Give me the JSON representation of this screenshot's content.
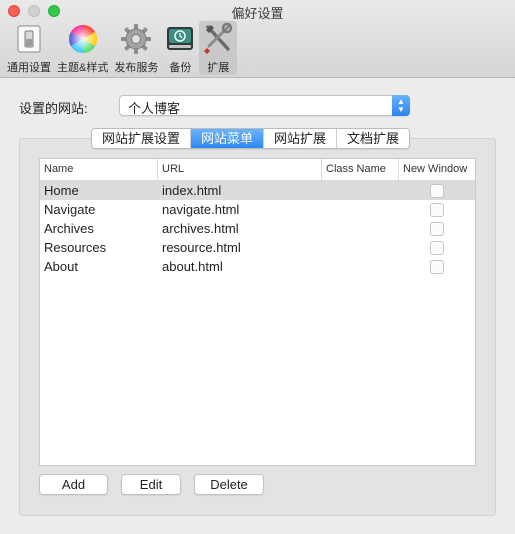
{
  "window": {
    "title": "偏好设置"
  },
  "toolbar": {
    "items": [
      {
        "label": "通用设置",
        "icon": "switch-icon"
      },
      {
        "label": "主题&样式",
        "icon": "color-wheel-icon"
      },
      {
        "label": "发布服务",
        "icon": "gear-icon"
      },
      {
        "label": "备份",
        "icon": "time-machine-drive-icon"
      },
      {
        "label": "扩展",
        "icon": "tools-icon"
      }
    ],
    "active": "扩展"
  },
  "site": {
    "label": "设置的网站:",
    "selected": "个人博客"
  },
  "tabs": [
    {
      "label": "网站扩展设置"
    },
    {
      "label": "网站菜单"
    },
    {
      "label": "网站扩展"
    },
    {
      "label": "文档扩展"
    }
  ],
  "active_tab": "网站菜单",
  "table": {
    "columns": [
      "Name",
      "URL",
      "Class Name",
      "New Window"
    ],
    "rows": [
      {
        "name": "Home",
        "url": "index.html",
        "class_name": "",
        "new_window": false
      },
      {
        "name": "Navigate",
        "url": "navigate.html",
        "class_name": "",
        "new_window": false
      },
      {
        "name": "Archives",
        "url": "archives.html",
        "class_name": "",
        "new_window": false
      },
      {
        "name": "Resources",
        "url": "resource.html",
        "class_name": "",
        "new_window": false
      },
      {
        "name": "About",
        "url": "about.html",
        "class_name": "",
        "new_window": false
      }
    ],
    "selected_row": "Home"
  },
  "buttons": {
    "add": "Add",
    "edit": "Edit",
    "delete": "Delete"
  },
  "colors": {
    "accent": "#2d87f3",
    "close": "#fc5f57",
    "maximize": "#34c84a"
  }
}
